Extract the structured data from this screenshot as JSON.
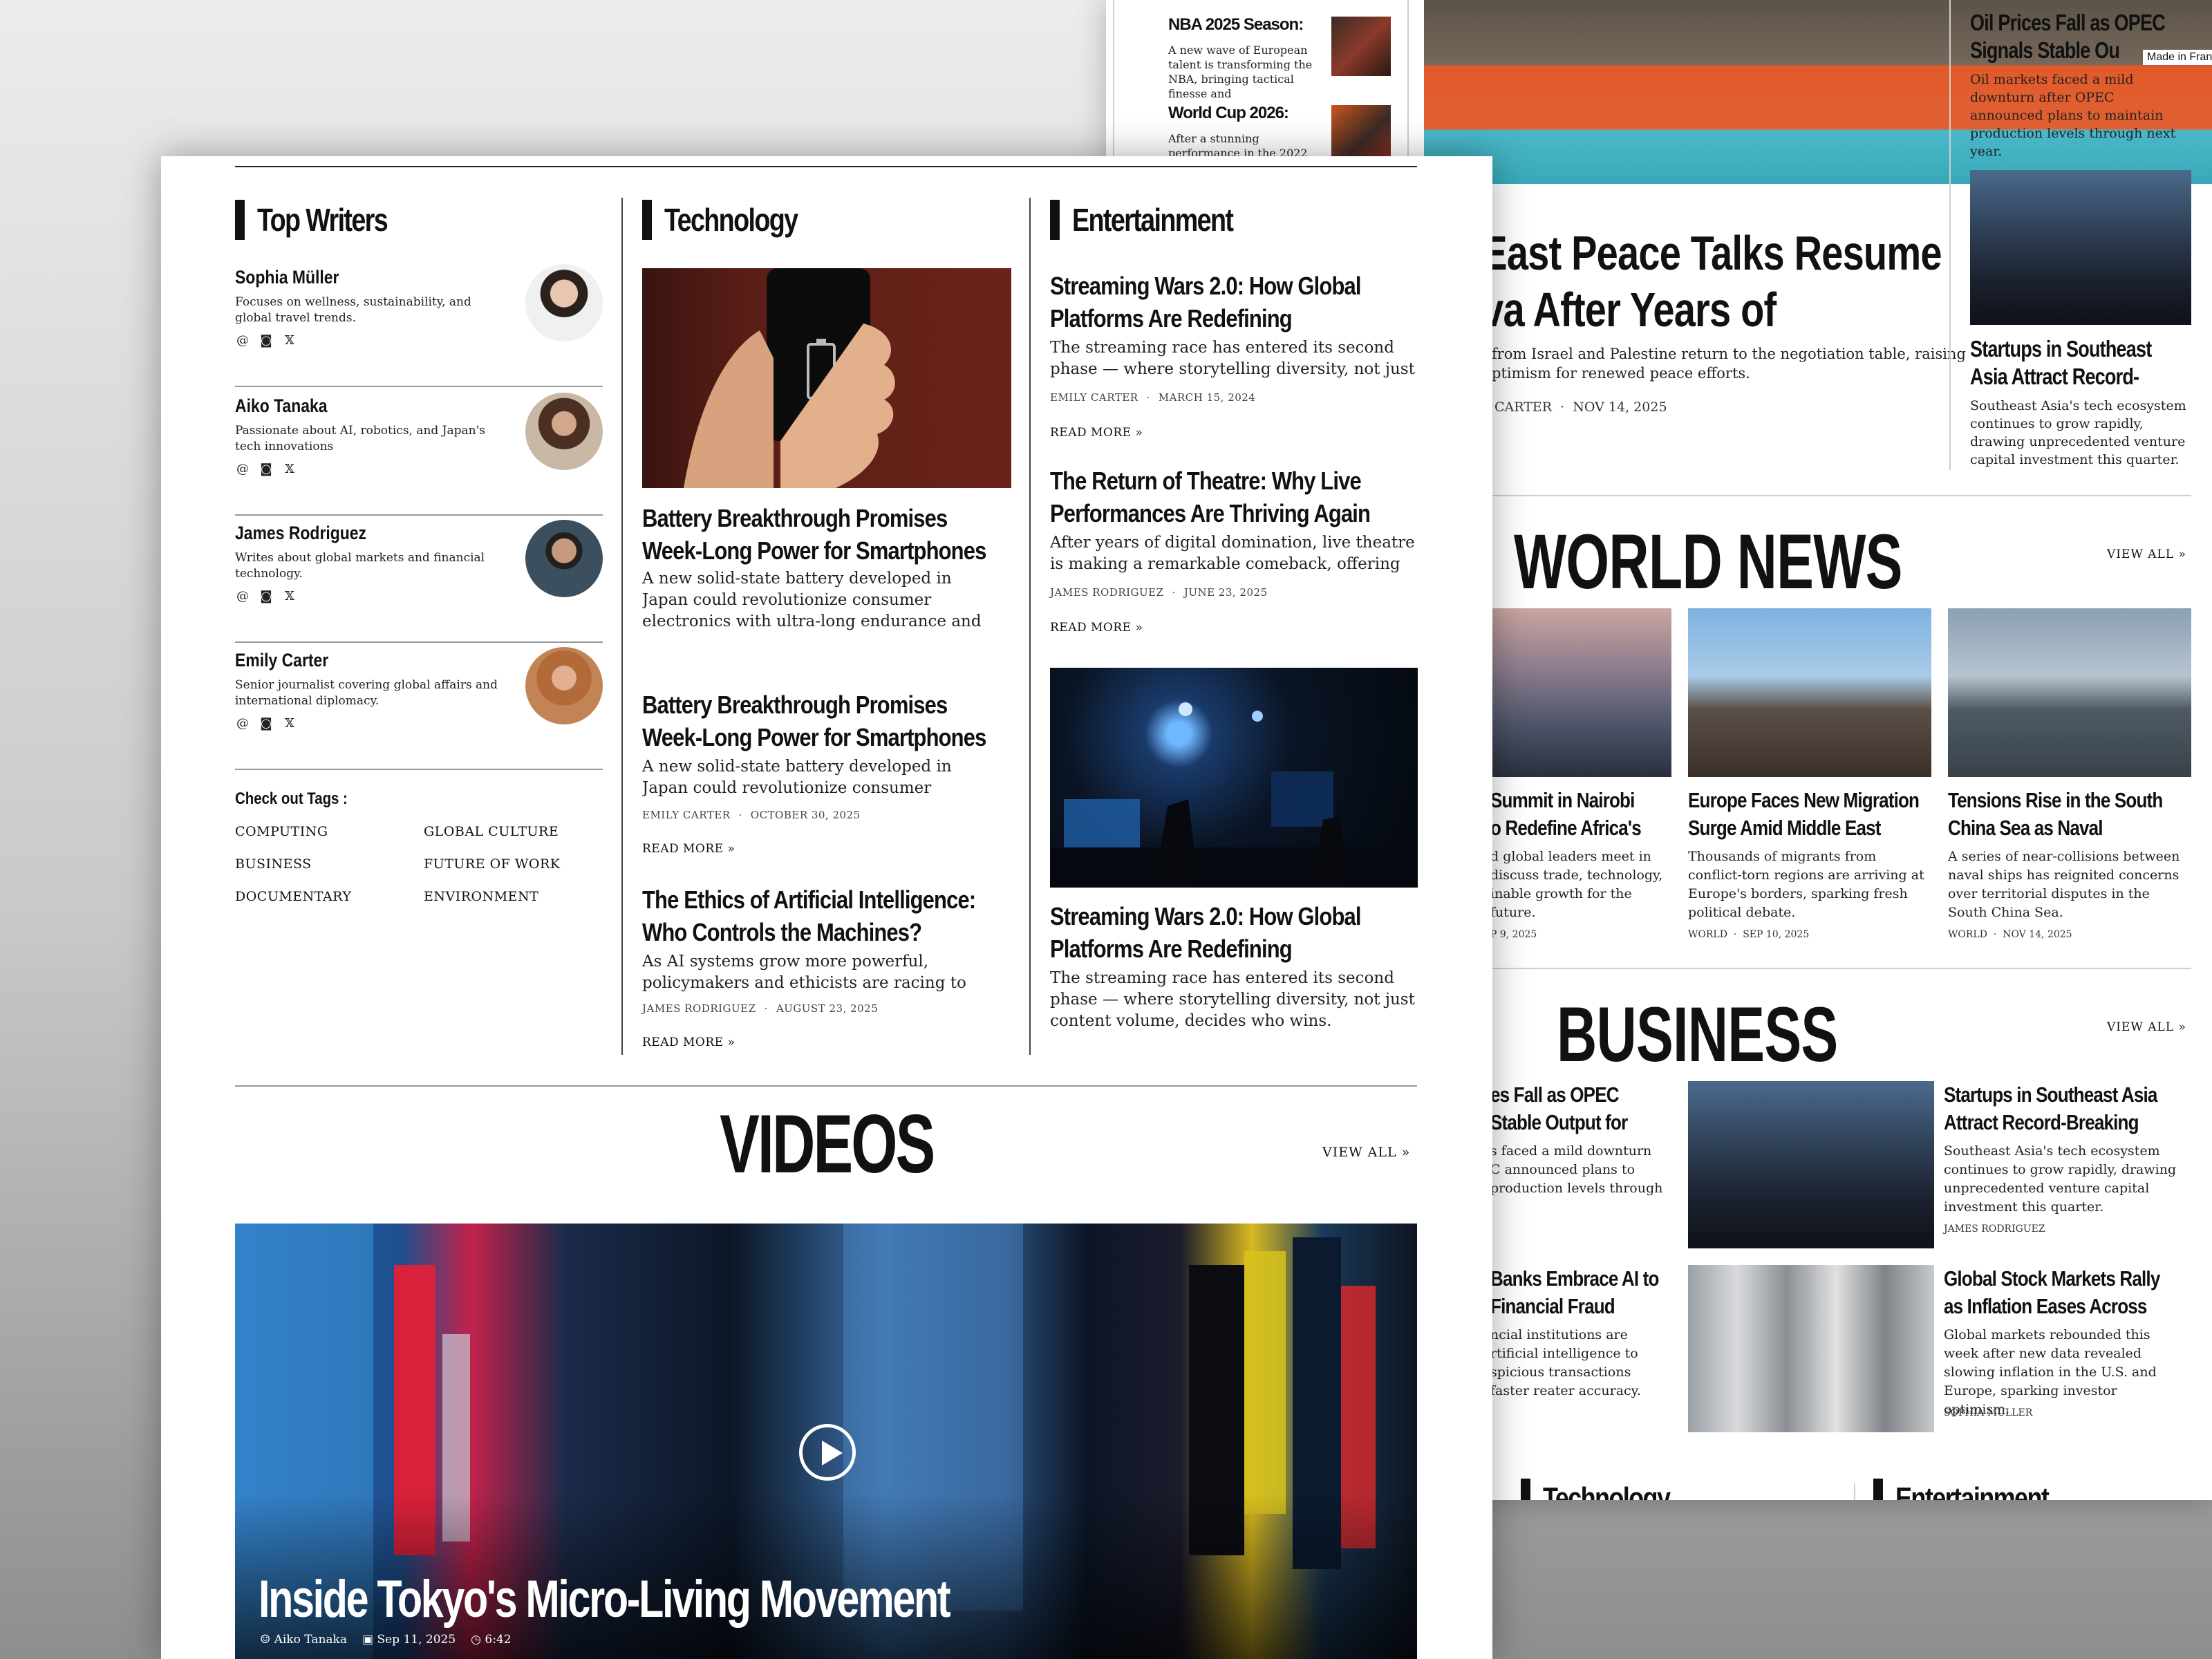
{
  "back": {
    "sports": [
      {
        "title": "NBA 2025 Season:",
        "excerpt": "A new wave of European talent is transforming the NBA, bringing tactical finesse and"
      },
      {
        "title": "World Cup 2026:",
        "excerpt": "After a stunning performance in the 2022 tournament,"
      }
    ],
    "hero": {
      "title_line1": "dle East Peace Talks Resume",
      "title_line2": "eneva After Years of",
      "excerpt_line1": "from Israel and Palestine return to the negotiation table, raising",
      "excerpt_line2": "ptimism for renewed peace efforts.",
      "author": "CARTER",
      "date": "NOV 14, 2025"
    },
    "side": [
      {
        "title_line1": "Oil Prices Fall as OPEC",
        "title_line2": "Signals Stable Ou",
        "excerpt": "Oil markets faced a mild downturn after OPEC announced plans to maintain production levels through next year."
      },
      {
        "title_line1": "Startups in Southeast",
        "title_line2": "Asia Attract Record-",
        "excerpt": "Southeast Asia's tech ecosystem continues to grow rapidly, drawing unprecedented venture capital investment this quarter."
      }
    ],
    "badge": "Made in Fran",
    "world_news": {
      "title": "WORLD NEWS",
      "view_all": "VIEW ALL",
      "items": [
        {
          "title_line1": "Summit in Nairobi",
          "title_line2": "o Redefine Africa's",
          "excerpt": "d global leaders meet in discuss trade, technology, inable growth for the future.",
          "meta": "P 9, 2025"
        },
        {
          "title_line1": "Europe Faces New Migration",
          "title_line2": "Surge Amid Middle East",
          "excerpt": "Thousands of migrants from conflict-torn regions are arriving at Europe's borders, sparking fresh political debate.",
          "category": "WORLD",
          "date": "SEP 10, 2025"
        },
        {
          "title_line1": "Tensions Rise in the South",
          "title_line2": "China Sea as Naval",
          "excerpt": "A series of near-collisions between naval ships has reignited concerns over territorial disputes in the South China Sea.",
          "category": "WORLD",
          "date": "NOV 14, 2025"
        }
      ]
    },
    "business": {
      "title": "BUSINESS",
      "view_all": "VIEW ALL",
      "left": [
        {
          "title_line1": "es Fall as OPEC",
          "title_line2": "Stable Output for",
          "excerpt": "s faced a mild downturn C announced plans to production levels through"
        },
        {
          "title_line1": "Banks Embrace AI to",
          "title_line2": "Financial Fraud",
          "excerpt": "ncial institutions are rtificial intelligence to spicious transactions faster reater accuracy."
        }
      ],
      "right": [
        {
          "title_line1": "Startups in Southeast Asia",
          "title_line2": "Attract Record-Breaking",
          "excerpt": "Southeast Asia's tech ecosystem continues to grow rapidly, drawing unprecedented venture capital investment this quarter.",
          "author": "JAMES RODRIGUEZ"
        },
        {
          "title_line1": "Global Stock Markets Rally",
          "title_line2": "as Inflation Eases Across",
          "excerpt": "Global markets rebounded this week after new data revealed slowing inflation in the U.S. and Europe, sparking investor optimism.",
          "author": "SOPHIA MÜLLER"
        }
      ]
    },
    "bottom_sections": [
      "Technology",
      "Entertainment"
    ]
  },
  "top_writers": {
    "title": "Top Writers",
    "writers": [
      {
        "name": "Sophia Müller",
        "bio": "Focuses on wellness, sustainability, and global travel trends."
      },
      {
        "name": "Aiko Tanaka",
        "bio": "Passionate about AI, robotics, and Japan's tech innovations"
      },
      {
        "name": "James Rodriguez",
        "bio": "Writes about global markets and financial technology."
      },
      {
        "name": "Emily Carter",
        "bio": "Senior journalist covering global affairs and international diplomacy."
      }
    ],
    "tags_title": "Check out Tags :",
    "tags": [
      "COMPUTING",
      "GLOBAL CULTURE",
      "BUSINESS",
      "FUTURE OF WORK",
      "DOCUMENTARY",
      "ENVIRONMENT"
    ]
  },
  "technology": {
    "title": "Technology",
    "featured": {
      "title_line1": "Battery Breakthrough Promises",
      "title_line2": "Week-Long Power for Smartphones",
      "excerpt": "A new solid-state battery developed in Japan could revolutionize consumer electronics with ultra-long endurance and fast charging."
    },
    "articles": [
      {
        "title_line1": "Battery Breakthrough Promises",
        "title_line2": "Week-Long Power for Smartphones",
        "excerpt": "A new solid-state battery developed in Japan could revolutionize consumer electronics with",
        "author": "EMILY CARTER",
        "date": "OCTOBER 30, 2025",
        "read_more": "READ MORE"
      },
      {
        "title_line1": "The Ethics of Artificial Intelligence:",
        "title_line2": "Who Controls the Machines?",
        "excerpt": "As AI systems grow more powerful, policymakers and ethicists are racing to define",
        "author": "JAMES RODRIGUEZ",
        "date": "AUGUST 23, 2025",
        "read_more": "READ MORE"
      }
    ]
  },
  "entertainment": {
    "title": "Entertainment",
    "articles": [
      {
        "title_line1": "Streaming Wars 2.0: How Global",
        "title_line2": "Platforms Are Redefining",
        "excerpt": "The streaming race has entered its second phase — where storytelling diversity, not just content",
        "author": "EMILY CARTER",
        "date": "MARCH 15, 2024",
        "read_more": "READ MORE"
      },
      {
        "title_line1": "The Return of Theatre: Why Live",
        "title_line2": "Performances Are Thriving Again",
        "excerpt": "After years of digital domination, live theatre is making a remarkable comeback, offering",
        "author": "JAMES RODRIGUEZ",
        "date": "JUNE 23, 2025",
        "read_more": "READ MORE"
      }
    ],
    "featured": {
      "title_line1": "Streaming Wars 2.0: How Global",
      "title_line2": "Platforms Are Redefining",
      "excerpt": "The streaming race has entered its second phase — where storytelling diversity, not just content volume, decides who wins."
    }
  },
  "videos": {
    "title": "VIDEOS",
    "view_all": "VIEW ALL",
    "featured": {
      "title": "Inside Tokyo's Micro-Living Movement",
      "author": "Aiko Tanaka",
      "date": "Sep 11, 2025",
      "duration": "6:42"
    }
  }
}
